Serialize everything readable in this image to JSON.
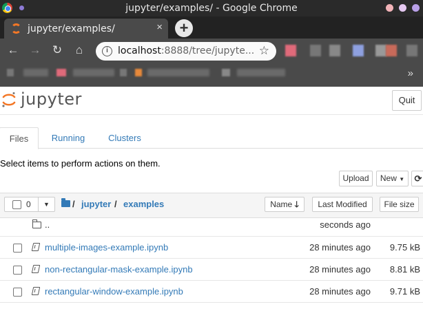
{
  "window": {
    "title": "jupyter/examples/ - Google Chrome"
  },
  "tab": {
    "title": "jupyter/examples/",
    "close": "×",
    "new_tab": "+"
  },
  "toolbar": {
    "back": "←",
    "forward": "→",
    "reload": "↻",
    "home": "⌂",
    "url_host": "localhost",
    "url_rest": ":8888/tree/jupyte...",
    "star": "☆",
    "overflow": "»"
  },
  "jupyter": {
    "logo_text": "jupyter",
    "quit_label": "Quit",
    "tabs": [
      {
        "label": "Files",
        "active": true
      },
      {
        "label": "Running",
        "active": false
      },
      {
        "label": "Clusters",
        "active": false
      }
    ],
    "instructions": "Select items to perform actions on them.",
    "upload_label": "Upload",
    "new_label": "New",
    "refresh_icon": "⟳"
  },
  "list": {
    "selected_count": "0",
    "breadcrumb": {
      "root": "/",
      "parts": [
        "jupyter",
        "examples"
      ],
      "sep": "/"
    },
    "sort": {
      "name": "Name",
      "last_modified": "Last Modified",
      "file_size": "File size"
    },
    "parent": {
      "name": "..",
      "modified": "seconds ago"
    },
    "items": [
      {
        "name": "multiple-images-example.ipynb",
        "modified": "28 minutes ago",
        "size": "9.75 kB"
      },
      {
        "name": "non-rectangular-mask-example.ipynb",
        "modified": "28 minutes ago",
        "size": "8.81 kB"
      },
      {
        "name": "rectangular-window-example.ipynb",
        "modified": "28 minutes ago",
        "size": "9.71 kB"
      }
    ]
  },
  "colors": {
    "link": "#337ab7",
    "jupyter_orange": "#f37726",
    "chrome_frame": "#4a4a4a"
  }
}
